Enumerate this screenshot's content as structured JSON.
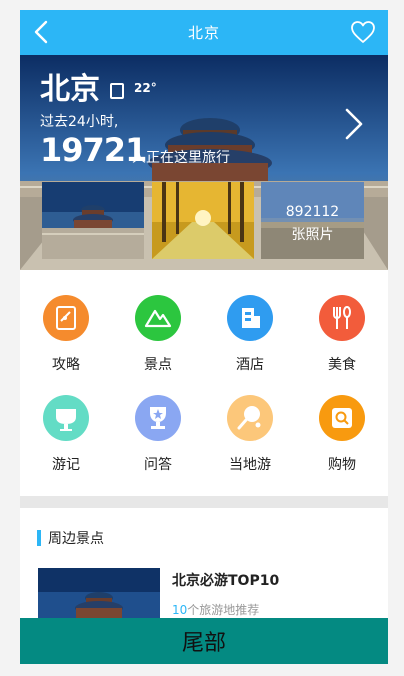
{
  "header": {
    "title": "北京",
    "back_icon": "back-arrow-icon",
    "fav_icon": "heart-icon"
  },
  "hero": {
    "city": "北京",
    "temperature": "22°",
    "weather_icon": "weather-icon",
    "past_label": "过去24小时,",
    "visitor_count": "19721",
    "visitor_label": "人正在这里旅行",
    "photos_count": "892112",
    "photos_label": "张照片"
  },
  "categories": [
    {
      "label": "攻略",
      "icon": "guide-icon",
      "color": "#f58b2d"
    },
    {
      "label": "景点",
      "icon": "mountain-icon",
      "color": "#2cc63f"
    },
    {
      "label": "酒店",
      "icon": "hotel-icon",
      "color": "#2f9cf0"
    },
    {
      "label": "美食",
      "icon": "food-icon",
      "color": "#f25c3b"
    },
    {
      "label": "游记",
      "icon": "travelogue-icon",
      "color": "#63dcc5"
    },
    {
      "label": "问答",
      "icon": "qa-trophy-icon",
      "color": "#8aa7f2"
    },
    {
      "label": "当地游",
      "icon": "local-tour-icon",
      "color": "#fcc77a"
    },
    {
      "label": "购物",
      "icon": "shopping-icon",
      "color": "#f89a0f"
    }
  ],
  "nearby": {
    "title": "周边景点",
    "item": {
      "title": "北京必游TOP10",
      "count": "10",
      "subtitle": "个旅游地推荐"
    }
  },
  "footer": {
    "label": "尾部"
  },
  "colors": {
    "accent": "#2cb6f6",
    "footer": "#048a82",
    "separator": "#e7e7e7"
  }
}
